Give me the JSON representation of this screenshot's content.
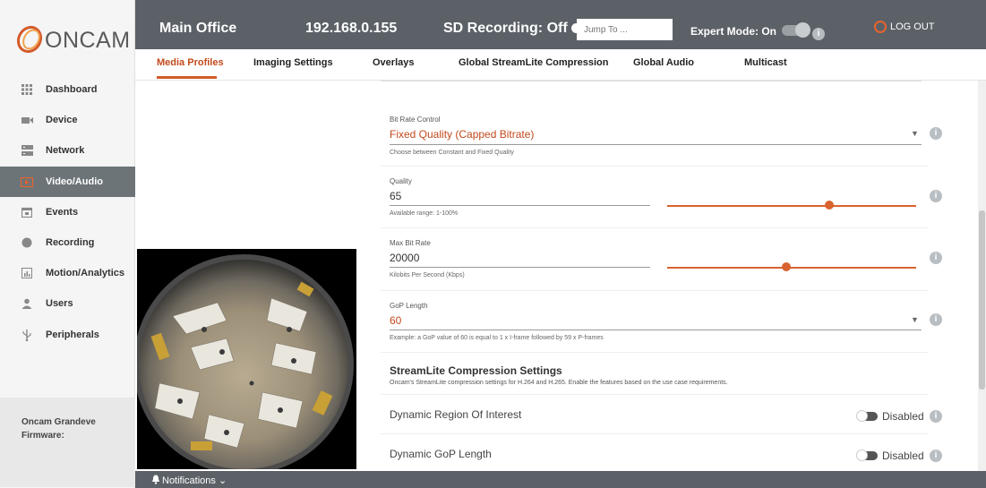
{
  "brand": {
    "logo_text": "ONCAM",
    "accent": "#d35b2a"
  },
  "header": {
    "location": "Main Office",
    "ip": "192.168.0.155",
    "sd_recording": "SD Recording: Off",
    "jump_placeholder": "Jump To ...",
    "expert_mode": "Expert Mode: On",
    "logout": "LOG OUT"
  },
  "tabs": [
    {
      "label": "Media Profiles",
      "active": true
    },
    {
      "label": "Imaging Settings"
    },
    {
      "label": "Overlays"
    },
    {
      "label": "Global StreamLite Compression"
    },
    {
      "label": "Global Audio"
    },
    {
      "label": "Multicast"
    }
  ],
  "sidebar": {
    "items": [
      {
        "label": "Dashboard",
        "icon": "grid-icon"
      },
      {
        "label": "Device",
        "icon": "camera-icon"
      },
      {
        "label": "Network",
        "icon": "network-icon"
      },
      {
        "label": "Video/Audio",
        "icon": "play-icon",
        "active": true
      },
      {
        "label": "Events",
        "icon": "calendar-icon"
      },
      {
        "label": "Recording",
        "icon": "record-icon"
      },
      {
        "label": "Motion/Analytics",
        "icon": "chart-icon"
      },
      {
        "label": "Users",
        "icon": "user-icon"
      },
      {
        "label": "Peripherals",
        "icon": "usb-icon"
      }
    ],
    "firmware_line1": "Oncam Grandeve",
    "firmware_line2": "Firmware:"
  },
  "settings": {
    "bitrate_control": {
      "label": "Bit Rate Control",
      "value": "Fixed Quality (Capped Bitrate)",
      "help": "Choose between Constant and Fixed Quality"
    },
    "quality": {
      "label": "Quality",
      "value": "65",
      "help": "Available range: 1-100%",
      "slider_fraction": 0.65
    },
    "max_bitrate": {
      "label": "Max Bit Rate",
      "value": "20000",
      "help": "Kilobits Per Second (Kbps)",
      "slider_fraction": 0.48
    },
    "gop_length": {
      "label": "GoP Length",
      "value": "60",
      "help": "Example: a GoP value of 60 is equal to 1 x I-frame followed by 59 x P-frames"
    },
    "streamlite": {
      "title": "StreamLite Compression Settings",
      "subtitle": "Oncam's StreamLite compression settings for H.264 and H.265. Enable the features based on the use case requirements."
    },
    "dynamic_roi": {
      "label": "Dynamic Region Of Interest",
      "state": "Disabled"
    },
    "dynamic_gop": {
      "label": "Dynamic GoP Length",
      "state": "Disabled"
    }
  },
  "notifications": {
    "label": "Notifications"
  }
}
